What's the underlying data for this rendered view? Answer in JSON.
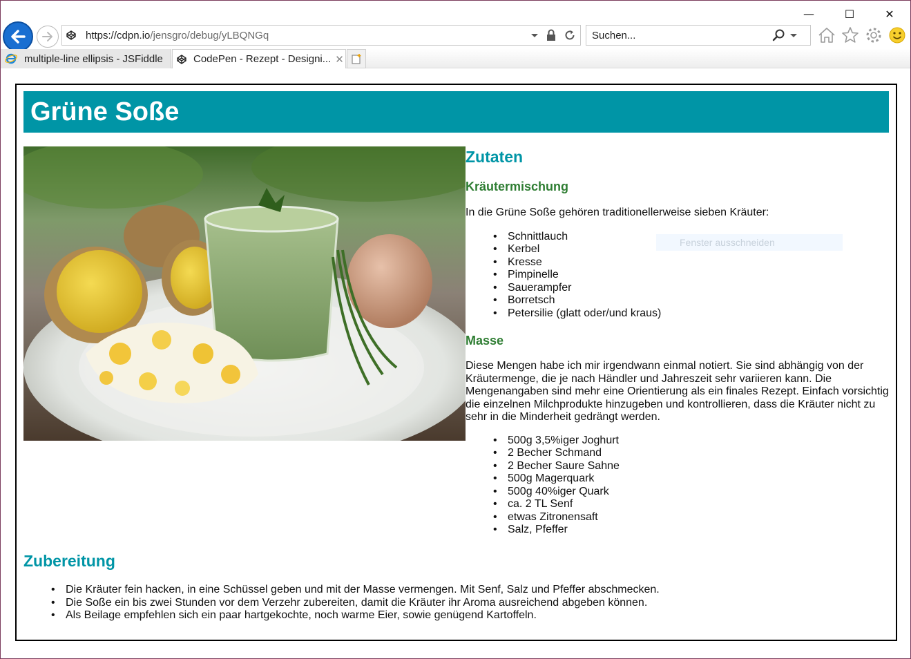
{
  "window": {
    "minimize": "—",
    "maximize": "☐",
    "close": "✕"
  },
  "address_bar": {
    "url_host": "https://cdpn.io",
    "url_path": "/jensgro/debug/yLBQNGq"
  },
  "search_box": {
    "placeholder": "Suchen..."
  },
  "tabs": [
    {
      "label": "multiple-line ellipsis - JSFiddle"
    },
    {
      "label": "CodePen - Rezept - Designi...",
      "close": "✕"
    }
  ],
  "recipe": {
    "title": "Grüne Soße",
    "zutaten_heading": "Zutaten",
    "kraeuter_heading": "Kräutermischung",
    "kraeuter_intro": "In die Grüne Soße gehören traditionellerweise sieben Kräuter:",
    "kraeuter": [
      "Schnittlauch",
      "Kerbel",
      "Kresse",
      "Pimpinelle",
      "Sauerampfer",
      "Borretsch",
      "Petersilie (glatt oder/und kraus)"
    ],
    "masse_heading": "Masse",
    "masse_intro": "Diese Mengen habe ich mir irgendwann einmal notiert. Sie sind abhängig von der Kräutermenge, die je nach Händler und Jahreszeit sehr variieren kann. Die Mengenangaben sind mehr eine Orientierung als ein finales Rezept. Einfach vorsichtig die einzelnen Milchprodukte hinzugeben und kontrollieren, dass die Kräuter nicht zu sehr in die Minderheit gedrängt werden.",
    "masse": [
      "500g 3,5%iger Joghurt",
      "2 Becher Schmand",
      "2 Becher Saure Sahne",
      "500g Magerquark",
      "500g 40%iger Quark",
      "ca. 2 TL Senf",
      "etwas Zitronensaft",
      "Salz, Pfeffer"
    ],
    "zubereitung_heading": "Zubereitung",
    "zubereitung": [
      "Die Kräuter fein hacken, in eine Schüssel geben und mit der Masse vermengen. Mit Senf, Salz und Pfeffer abschmecken.",
      "Die Soße ein bis zwei Stunden vor dem Verzehr zubereiten, damit die Kräuter ihr Aroma ausreichend abgeben können.",
      "Als Beilage empfehlen sich ein paar hartgekochte, noch warme Eier, sowie genügend Kartoffeln."
    ]
  },
  "overlay": {
    "snip_label": "Fenster ausschneiden"
  },
  "colors": {
    "banner": "#0095a6",
    "heading_teal": "#0095a6",
    "heading_green": "#2e7d32",
    "back_button": "#1a6fd1"
  }
}
